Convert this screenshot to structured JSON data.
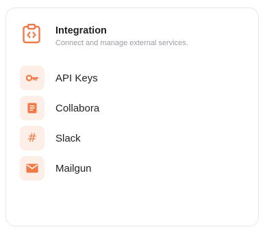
{
  "colors": {
    "accent": "#f07a47",
    "icon_bg": "#fdeee7",
    "title": "#1f1f24",
    "subtitle": "#9a9ca3",
    "border": "#e7e7ea"
  },
  "header": {
    "icon": "code-clipboard-icon",
    "title": "Integration",
    "subtitle": "Connect and manage external services."
  },
  "items": [
    {
      "label": "API Keys",
      "icon": "key-icon"
    },
    {
      "label": "Collabora",
      "icon": "document-icon"
    },
    {
      "label": "Slack",
      "icon": "hashtag-icon",
      "glyph": "#"
    },
    {
      "label": "Mailgun",
      "icon": "envelope-icon"
    }
  ]
}
